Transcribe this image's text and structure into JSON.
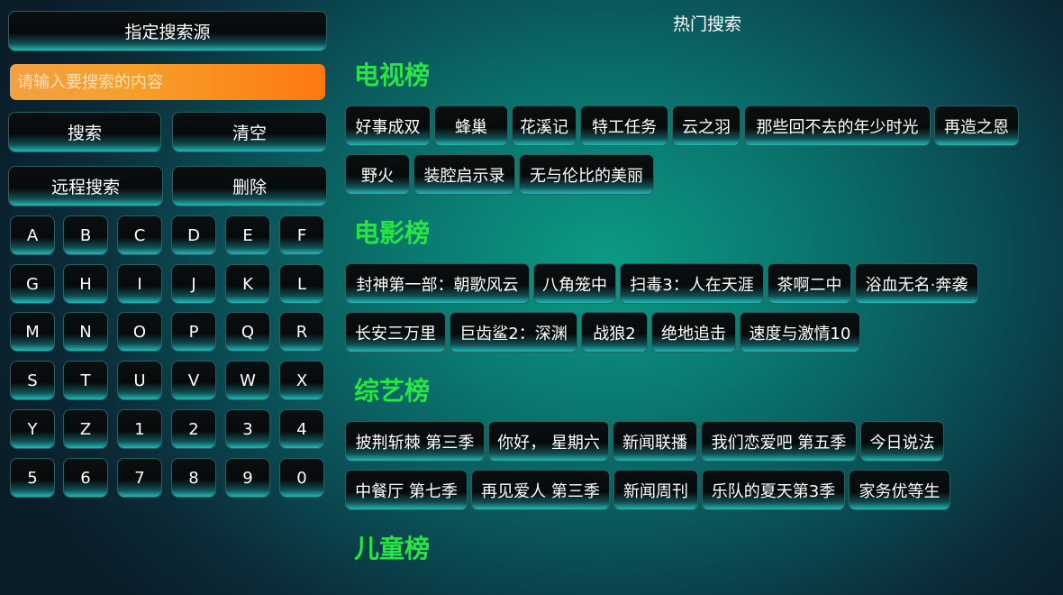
{
  "left_panel": {
    "source_button": "指定搜索源",
    "search_input": {
      "placeholder": "请输入要搜索的内容",
      "value": ""
    },
    "search_button": "搜索",
    "clear_button": "清空",
    "remote_search_button": "远程搜索",
    "delete_button": "删除",
    "keys": [
      "A",
      "B",
      "C",
      "D",
      "E",
      "F",
      "G",
      "H",
      "I",
      "J",
      "K",
      "L",
      "M",
      "N",
      "O",
      "P",
      "Q",
      "R",
      "S",
      "T",
      "U",
      "V",
      "W",
      "X",
      "Y",
      "Z",
      "1",
      "2",
      "3",
      "4",
      "5",
      "6",
      "7",
      "8",
      "9",
      "0"
    ]
  },
  "hot": {
    "title": "热门搜索",
    "sections": [
      {
        "title": "电视榜",
        "rows": [
          [
            "好事成双",
            "蜂巢",
            "花溪记",
            "特工任务",
            "云之羽",
            "那些回不去的年少时光",
            "再造之恩"
          ],
          [
            "野火",
            "装腔启示录",
            "无与伦比的美丽"
          ]
        ]
      },
      {
        "title": "电影榜",
        "rows": [
          [
            "封神第一部：朝歌风云",
            "八角笼中",
            "扫毒3：人在天涯",
            "茶啊二中",
            "浴血无名·奔袭"
          ],
          [
            "长安三万里",
            "巨齿鲨2：深渊",
            "战狼2",
            "绝地追击",
            "速度与激情10"
          ]
        ]
      },
      {
        "title": "综艺榜",
        "rows": [
          [
            "披荆斩棘 第三季",
            "你好， 星期六",
            "新闻联播",
            "我们恋爱吧 第五季",
            "今日说法"
          ],
          [
            "中餐厅 第七季",
            "再见爱人 第三季",
            "新闻周刊",
            "乐队的夏天第3季",
            "家务优等生"
          ]
        ]
      },
      {
        "title": "儿童榜",
        "rows": []
      }
    ]
  },
  "colors": {
    "section_title": "#27e640",
    "input_gradient_start": "#f3a142",
    "input_gradient_end": "#ff7810",
    "button_glow": "#1fb9b6"
  }
}
